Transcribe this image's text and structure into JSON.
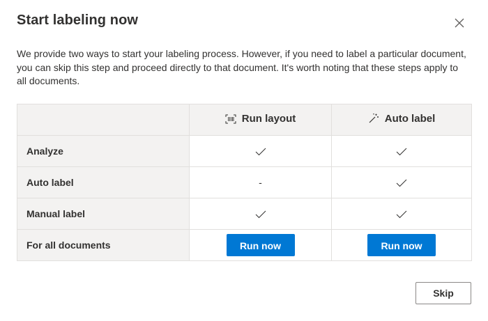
{
  "dialog": {
    "title": "Start labeling now",
    "description": "We provide two ways to start your labeling process. However, if you need to label a particular document, you can skip this step and proceed directly to that document. It's worth noting that these steps apply to all documents.",
    "close_icon": "close-icon"
  },
  "table": {
    "columns": [
      {
        "label": "Run layout",
        "icon": "layout-scan-icon"
      },
      {
        "label": "Auto label",
        "icon": "magic-wand-icon"
      }
    ],
    "rows": [
      {
        "label": "Analyze",
        "run_layout": "check",
        "auto_label": "check"
      },
      {
        "label": "Auto label",
        "run_layout": "-",
        "auto_label": "check"
      },
      {
        "label": "Manual label",
        "run_layout": "check",
        "auto_label": "check"
      },
      {
        "label": "For all documents",
        "run_layout_button": "Run now",
        "auto_label_button": "Run now"
      }
    ]
  },
  "footer": {
    "skip_label": "Skip"
  },
  "colors": {
    "primary": "#0078d4",
    "header_bg": "#f3f2f1",
    "border": "#e1dfdd"
  }
}
